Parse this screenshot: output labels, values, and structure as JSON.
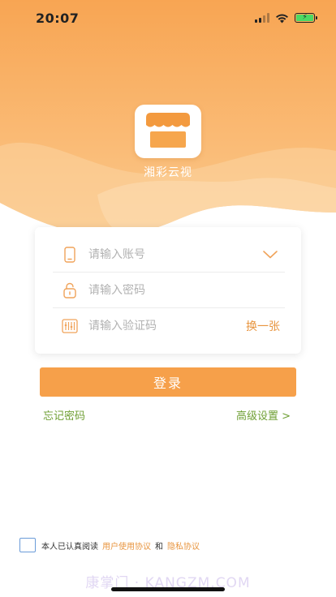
{
  "status_bar": {
    "time": "20:07"
  },
  "app": {
    "name": "湘彩云视"
  },
  "login_form": {
    "account_placeholder": "请输入账号",
    "password_placeholder": "请输入密码",
    "captcha_placeholder": "请输入验证码",
    "captcha_refresh_label": "换一张"
  },
  "actions": {
    "login_label": "登录",
    "forgot_password_label": "忘记密码",
    "advanced_settings_label": "高级设置 >"
  },
  "agreement": {
    "prefix": "本人已认真阅读",
    "user_agreement": "用户使用协议",
    "and": "和",
    "privacy_policy": "隐私协议"
  },
  "watermark": "康掌门 · KANGZM.COM",
  "colors": {
    "accent": "#f6a04a",
    "link_green": "#6f9f34",
    "link_orange": "#e8953f"
  },
  "icons": [
    "phone-icon",
    "lock-icon",
    "captcha-icon",
    "chevron-down-icon",
    "store-icon",
    "wifi-icon",
    "battery-icon",
    "signal-icon"
  ]
}
